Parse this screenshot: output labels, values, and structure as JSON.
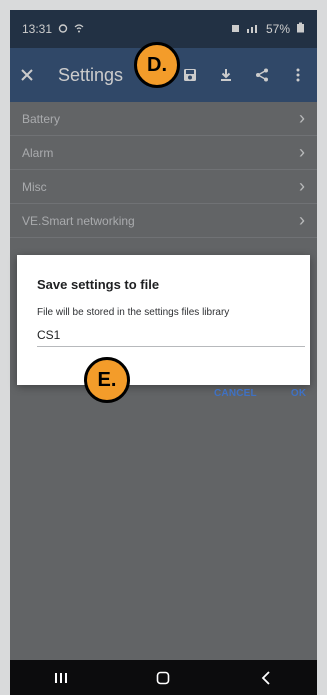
{
  "status_bar": {
    "time": "13:31",
    "battery": "57%"
  },
  "app_bar": {
    "title": "Settings"
  },
  "menu": {
    "items": [
      {
        "label": "Battery"
      },
      {
        "label": "Alarm"
      },
      {
        "label": "Misc"
      },
      {
        "label": "VE.Smart networking"
      }
    ]
  },
  "dialog": {
    "title": "Save settings to file",
    "message": "File will be stored in the settings files library",
    "file_name": "CS1",
    "cancel_label": "CANCEL",
    "ok_label": "OK"
  },
  "markers": {
    "d": "D.",
    "e": "E."
  },
  "colors": {
    "status_bar": "#2b3e55",
    "app_bar": "#3c5a82",
    "accent": "#3f71c3",
    "marker": "#f39c2a"
  },
  "icons": [
    "alarm-icon",
    "wifi-icon",
    "signal-icon",
    "battery-icon",
    "close-icon",
    "save-icon",
    "download-icon",
    "share-icon",
    "overflow-icon",
    "recent-apps-icon",
    "home-icon",
    "back-icon"
  ]
}
